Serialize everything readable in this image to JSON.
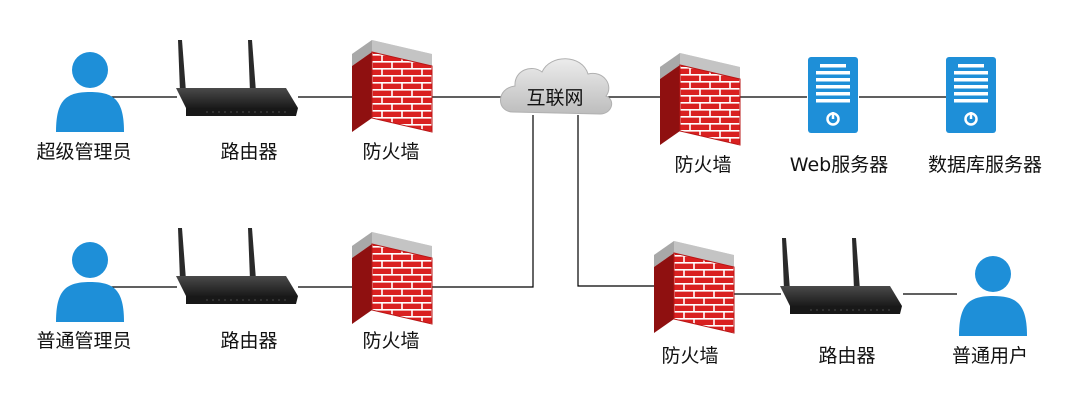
{
  "diagram": {
    "cloud": {
      "label": "互联网"
    },
    "nodes": {
      "super_admin": {
        "label": "超级管理员",
        "icon": "user-icon"
      },
      "router_1": {
        "label": "路由器",
        "icon": "router-icon"
      },
      "firewall_1": {
        "label": "防火墙",
        "icon": "firewall-icon"
      },
      "normal_admin": {
        "label": "普通管理员",
        "icon": "user-icon"
      },
      "router_2": {
        "label": "路由器",
        "icon": "router-icon"
      },
      "firewall_2": {
        "label": "防火墙",
        "icon": "firewall-icon"
      },
      "firewall_3": {
        "label": "防火墙",
        "icon": "firewall-icon"
      },
      "web_server": {
        "label": "Web服务器",
        "icon": "server-icon"
      },
      "db_server": {
        "label": "数据库服务器",
        "icon": "server-icon"
      },
      "firewall_4": {
        "label": "防火墙",
        "icon": "firewall-icon"
      },
      "router_3": {
        "label": "路由器",
        "icon": "router-icon"
      },
      "normal_user": {
        "label": "普通用户",
        "icon": "user-icon"
      }
    },
    "colors": {
      "user": "#1e8fd8",
      "server": "#1e8fd8",
      "brick": "#d92020",
      "mortar": "#ffffff",
      "wall_cap": "#bfbfbf",
      "router": "#2e2e2e",
      "cloud": "#d6d6d6",
      "link": "#000000"
    }
  }
}
